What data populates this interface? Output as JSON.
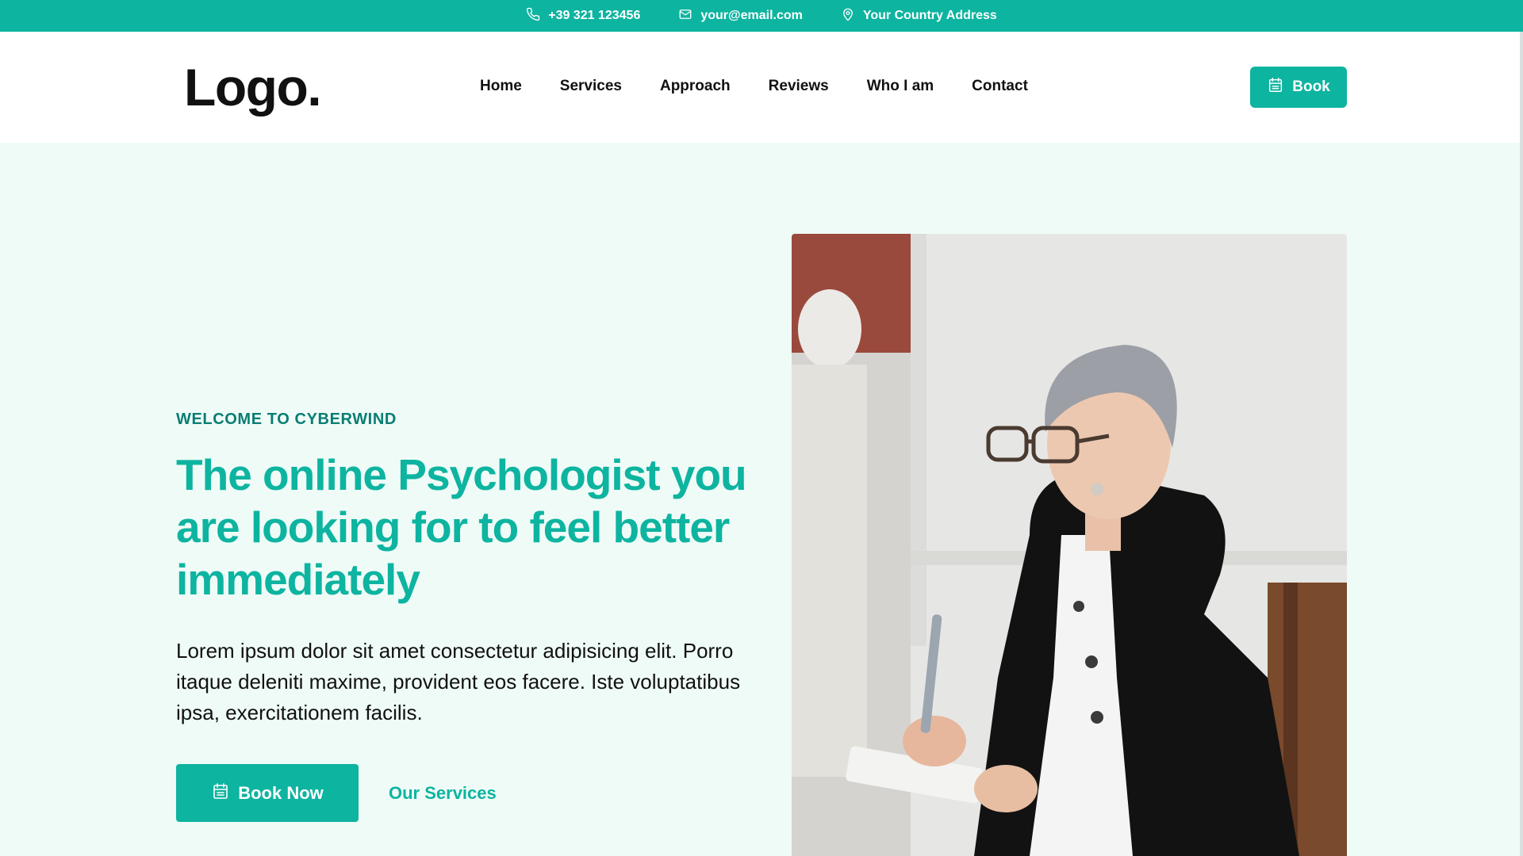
{
  "topbar": {
    "phone": "+39 321 123456",
    "email": "your@email.com",
    "address": "Your Country Address",
    "icons": [
      "phone-icon",
      "mail-icon",
      "location-pin-icon"
    ]
  },
  "header": {
    "logo": "Logo.",
    "nav": [
      "Home",
      "Services",
      "Approach",
      "Reviews",
      "Who I am",
      "Contact"
    ],
    "book_label": "Book"
  },
  "hero": {
    "eyebrow": "WELCOME TO CYBERWIND",
    "title": "The online Psychologist you are looking for to feel better immediately",
    "description": "Lorem ipsum dolor sit amet consectetur adipisicing elit. Porro itaque deleniti maxime, provident eos facere. Iste voluptatibus ipsa, exercitationem facilis.",
    "primary_button": "Book Now",
    "secondary_link": "Our Services"
  },
  "colors": {
    "accent": "#0db4a0",
    "eyebrow": "#0a7d74",
    "hero_background": "#effbf7",
    "text": "#111111"
  }
}
